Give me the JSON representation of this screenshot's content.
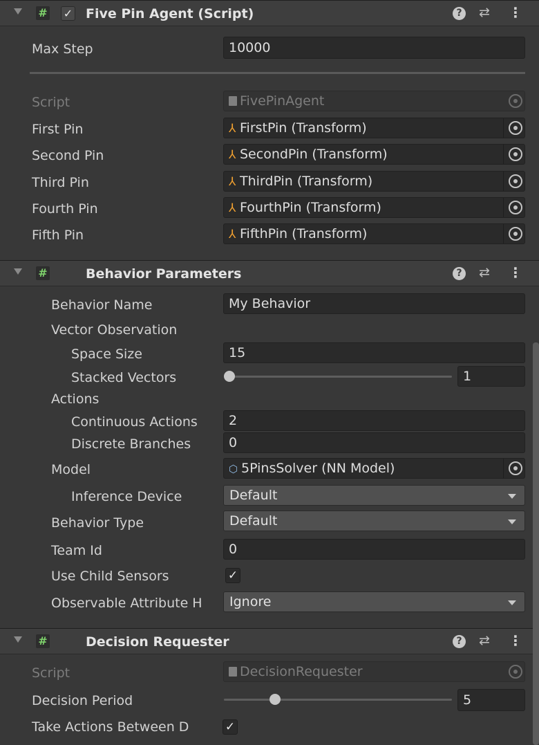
{
  "five_pin_agent": {
    "title": "Five Pin Agent (Script)",
    "enabled_check": "✓",
    "max_step_label": "Max Step",
    "max_step_value": "10000",
    "script_label": "Script",
    "script_value": "FivePinAgent",
    "pins": [
      {
        "label": "First Pin",
        "value": "FirstPin (Transform)"
      },
      {
        "label": "Second Pin",
        "value": "SecondPin (Transform)"
      },
      {
        "label": "Third Pin",
        "value": "ThirdPin (Transform)"
      },
      {
        "label": "Fourth Pin",
        "value": "FourthPin (Transform)"
      },
      {
        "label": "Fifth Pin",
        "value": "FifthPin (Transform)"
      }
    ]
  },
  "behavior_parameters": {
    "title": "Behavior Parameters",
    "behavior_name_label": "Behavior Name",
    "behavior_name_value": "My Behavior",
    "vector_observation_label": "Vector Observation",
    "space_size_label": "Space Size",
    "space_size_value": "15",
    "stacked_vectors_label": "Stacked Vectors",
    "stacked_vectors_value": "1",
    "actions_label": "Actions",
    "continuous_actions_label": "Continuous Actions",
    "continuous_actions_value": "2",
    "discrete_branches_label": "Discrete Branches",
    "discrete_branches_value": "0",
    "model_label": "Model",
    "model_value": "5PinsSolver (NN Model)",
    "inference_device_label": "Inference Device",
    "inference_device_value": "Default",
    "behavior_type_label": "Behavior Type",
    "behavior_type_value": "Default",
    "team_id_label": "Team Id",
    "team_id_value": "0",
    "use_child_sensors_label": "Use Child Sensors",
    "use_child_sensors_check": "✓",
    "observable_attribute_label": "Observable Attribute H",
    "observable_attribute_value": "Ignore"
  },
  "decision_requester": {
    "title": "Decision Requester",
    "script_label": "Script",
    "script_value": "DecisionRequester",
    "decision_period_label": "Decision Period",
    "decision_period_value": "5",
    "take_actions_label": "Take Actions Between D",
    "take_actions_check": "✓"
  },
  "icons": {
    "script": "#",
    "help": "?",
    "preset": "⇄",
    "menu": "⋮",
    "transform": "⅄",
    "model": "⬡"
  }
}
